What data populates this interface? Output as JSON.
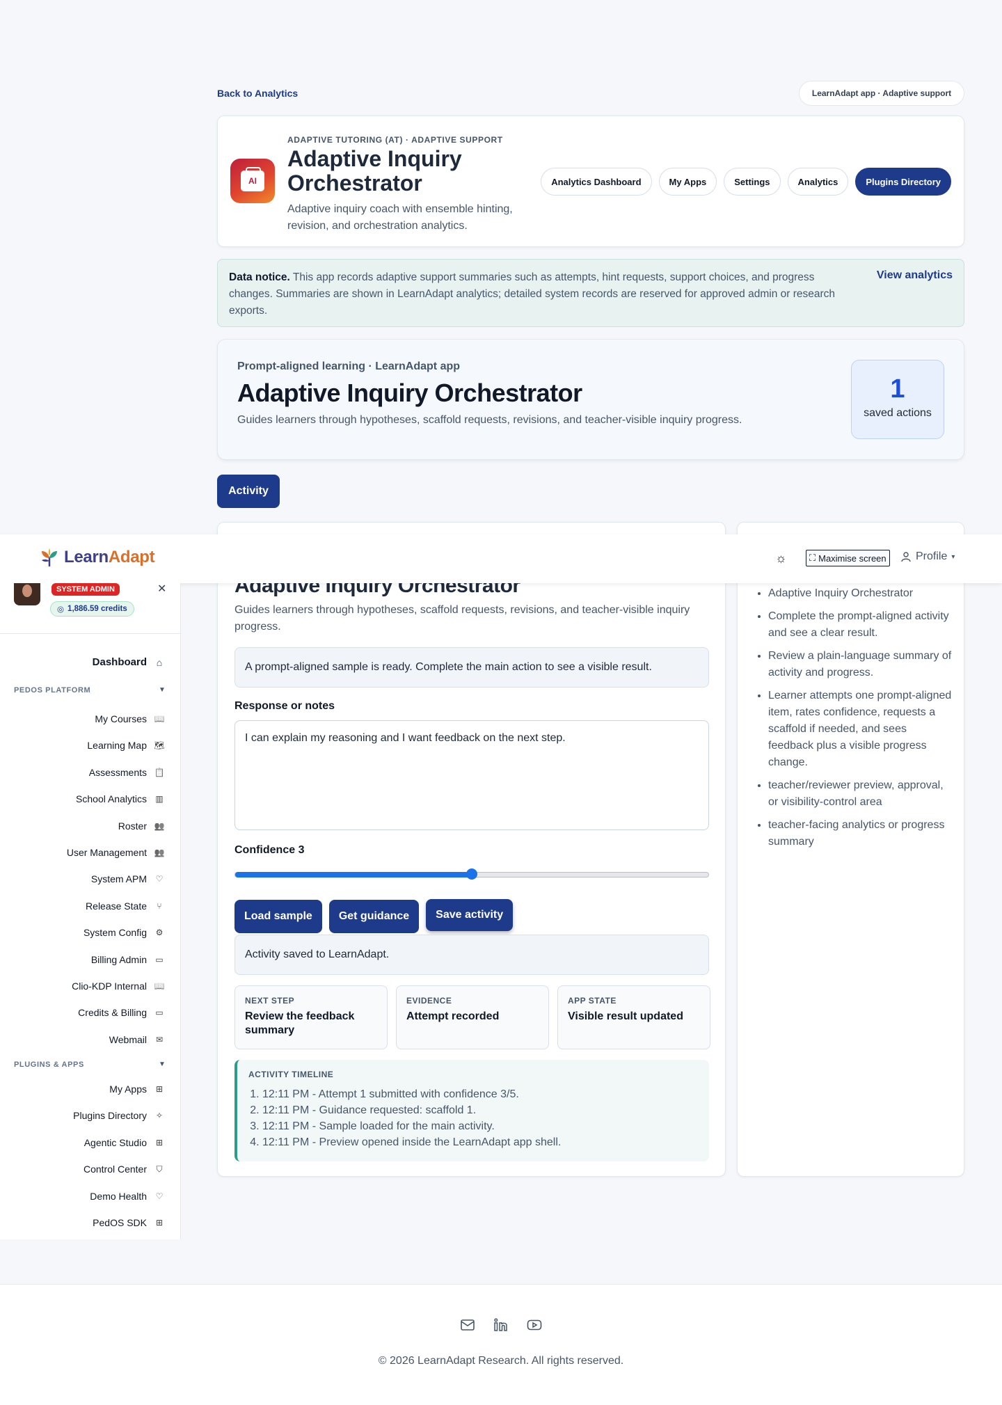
{
  "nav": {
    "back_label": "Back to Analytics",
    "context_pill": "LearnAdapt app · Adaptive support"
  },
  "app": {
    "eyebrow": "ADAPTIVE TUTORING (AT) · ADAPTIVE SUPPORT",
    "title": "Adaptive Inquiry Orchestrator",
    "description": "Adaptive inquiry coach with ensemble hinting, revision, and orchestration analytics.",
    "icon_text": "AI",
    "tabs": [
      {
        "label": "Analytics Dashboard"
      },
      {
        "label": "My Apps"
      },
      {
        "label": "Settings"
      },
      {
        "label": "Analytics"
      },
      {
        "label": "Plugins Directory"
      }
    ]
  },
  "notice": {
    "lead": "Data notice.",
    "body": "This app records adaptive support summaries such as attempts, hint requests, support choices, and progress changes. Summaries are shown in LearnAdapt analytics; detailed system records are reserved for approved admin or research exports.",
    "link": "View analytics"
  },
  "hero": {
    "eyebrow": "Prompt-aligned learning · LearnAdapt app",
    "title": "Adaptive Inquiry Orchestrator",
    "description": "Guides learners through hypotheses, scaffold requests, revisions, and teacher-visible inquiry progress.",
    "saved_count": "1",
    "saved_label": "saved actions"
  },
  "activity_tab": "Activity",
  "main_panel": {
    "title": "Adaptive Inquiry Orchestrator",
    "description": "Guides learners through hypotheses, scaffold requests, revisions, and teacher-visible inquiry progress.",
    "sample_message": "A prompt-aligned sample is ready. Complete the main action to see a visible result.",
    "notes_label": "Response or notes",
    "notes_value": "I can explain my reasoning and I want feedback on the next step.",
    "confidence_label": "Confidence 3",
    "confidence_fraction": 0.5,
    "buttons": {
      "load": "Load sample",
      "guidance": "Get guidance",
      "save": "Save activity"
    },
    "status_message": "Activity saved to LearnAdapt.",
    "cards": [
      {
        "key": "NEXT STEP",
        "value": "Review the feedback summary"
      },
      {
        "key": "EVIDENCE",
        "value": "Attempt recorded"
      },
      {
        "key": "APP STATE",
        "value": "Visible result updated"
      }
    ],
    "timeline_heading": "ACTIVITY TIMELINE",
    "timeline": [
      "12:11 PM - Attempt 1 submitted with confidence 3/5.",
      "12:11 PM - Guidance requested: scaffold 1.",
      "12:11 PM - Sample loaded for the main activity.",
      "12:11 PM - Preview opened inside the LearnAdapt app shell."
    ]
  },
  "side_panel": {
    "items": [
      "Adaptive Inquiry Orchestrator",
      "Complete the prompt-aligned activity and see a clear result.",
      "Review a plain-language summary of activity and progress.",
      "Learner attempts one prompt-aligned item, rates confidence, requests a scaffold if needed, and sees feedback plus a visible progress change.",
      "teacher/reviewer preview, approval, or visibility-control area",
      "teacher-facing analytics or progress summary"
    ]
  },
  "topbar": {
    "logo_part1": "Learn",
    "logo_part2": "Adapt",
    "maximise_label": "Maximise screen",
    "profile_label": "Profile"
  },
  "sidebar": {
    "badge": "SYSTEM ADMIN",
    "credits": "1,886.59 credits",
    "dashboard": "Dashboard",
    "section_platform": "PEDOS PLATFORM",
    "platform_items": [
      {
        "label": "My Courses",
        "icon": "book-icon"
      },
      {
        "label": "Learning Map",
        "icon": "map-icon"
      },
      {
        "label": "Assessments",
        "icon": "clipboard-icon"
      },
      {
        "label": "School Analytics",
        "icon": "bar-chart-icon"
      },
      {
        "label": "Roster",
        "icon": "users-icon"
      },
      {
        "label": "User Management",
        "icon": "users-icon"
      },
      {
        "label": "System APM",
        "icon": "heart-icon"
      },
      {
        "label": "Release State",
        "icon": "git-branch-icon"
      },
      {
        "label": "System Config",
        "icon": "gear-icon"
      },
      {
        "label": "Billing Admin",
        "icon": "card-icon"
      },
      {
        "label": "Clio-KDP Internal",
        "icon": "book-icon"
      },
      {
        "label": "Credits & Billing",
        "icon": "card-icon"
      },
      {
        "label": "Webmail",
        "icon": "mail-icon"
      }
    ],
    "section_plugins": "PLUGINS & APPS",
    "plugin_items": [
      {
        "label": "My Apps",
        "icon": "grid-icon"
      },
      {
        "label": "Plugins Directory",
        "icon": "puzzle-icon"
      },
      {
        "label": "Agentic Studio",
        "icon": "grid-icon"
      },
      {
        "label": "Control Center",
        "icon": "shield-icon"
      },
      {
        "label": "Demo Health",
        "icon": "heart-icon"
      },
      {
        "label": "PedOS SDK",
        "icon": "grid-icon"
      }
    ]
  },
  "footer": {
    "copyright": "© 2026 LearnAdapt Research. All rights reserved."
  }
}
